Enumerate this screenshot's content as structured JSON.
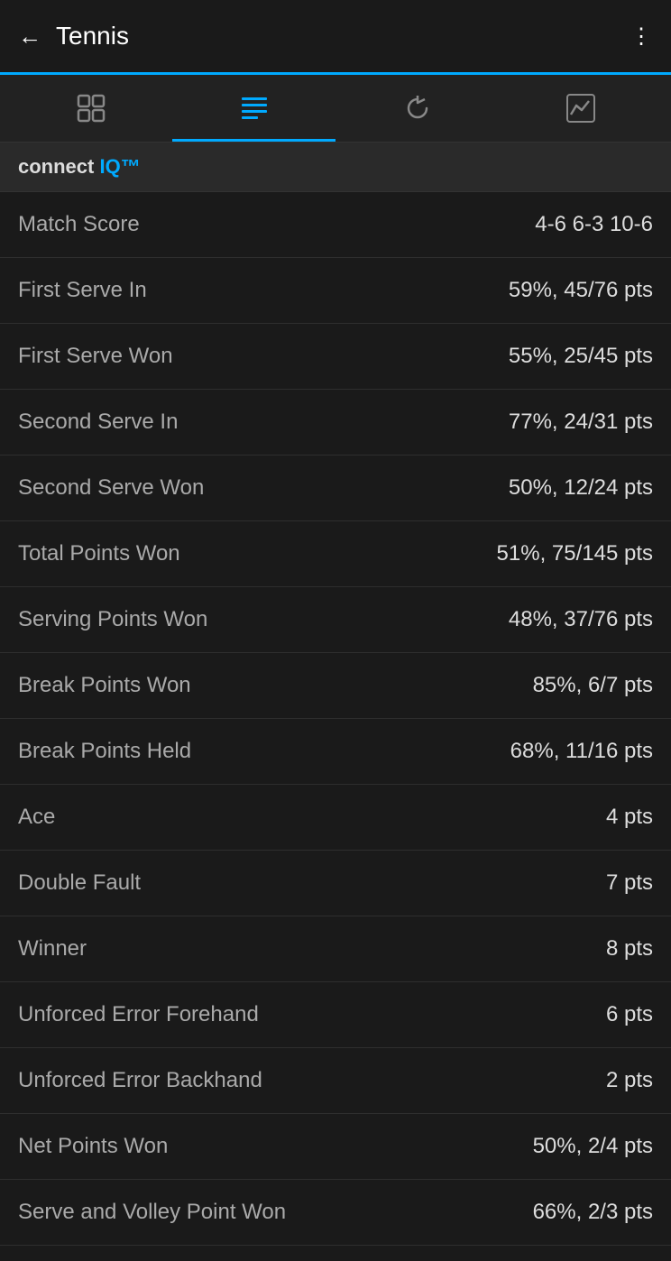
{
  "header": {
    "title": "Tennis",
    "back_label": "←",
    "menu_label": "⋮"
  },
  "tabs": [
    {
      "id": "activity",
      "icon": "🏃",
      "label": "Activity",
      "active": false
    },
    {
      "id": "stats",
      "icon": "📋",
      "label": "Stats",
      "active": true
    },
    {
      "id": "laps",
      "icon": "↺",
      "label": "Laps",
      "active": false
    },
    {
      "id": "charts",
      "icon": "📈",
      "label": "Charts",
      "active": false
    }
  ],
  "brand": {
    "text": "connect",
    "iq": "IQ"
  },
  "stats": [
    {
      "label": "Match Score",
      "value": "4-6 6-3 10-6"
    },
    {
      "label": "First Serve In",
      "value": "59%, 45/76 pts"
    },
    {
      "label": "First Serve Won",
      "value": "55%, 25/45 pts"
    },
    {
      "label": "Second Serve In",
      "value": "77%, 24/31 pts"
    },
    {
      "label": "Second Serve Won",
      "value": "50%, 12/24 pts"
    },
    {
      "label": "Total Points Won",
      "value": "51%, 75/145 pts"
    },
    {
      "label": "Serving Points Won",
      "value": "48%, 37/76 pts"
    },
    {
      "label": "Break Points Won",
      "value": "85%, 6/7 pts"
    },
    {
      "label": "Break Points Held",
      "value": "68%, 11/16 pts"
    },
    {
      "label": "Ace",
      "value": "4 pts"
    },
    {
      "label": "Double Fault",
      "value": "7 pts"
    },
    {
      "label": "Winner",
      "value": "8 pts"
    },
    {
      "label": "Unforced Error Forehand",
      "value": "6 pts"
    },
    {
      "label": "Unforced Error Backhand",
      "value": "2 pts"
    },
    {
      "label": "Net Points Won",
      "value": "50%, 2/4 pts"
    },
    {
      "label": "Serve and Volley Point Won",
      "value": "66%, 2/3 pts"
    }
  ]
}
